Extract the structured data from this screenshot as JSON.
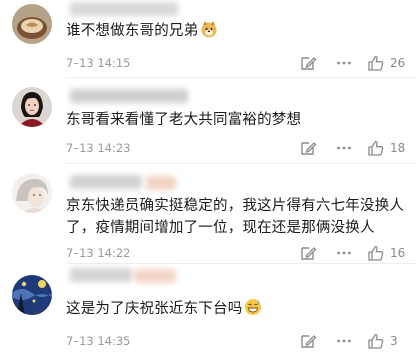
{
  "comments": [
    {
      "text": "谁不想做东哥的兄弟",
      "emoji": "doge-emoji",
      "time": "7–13 14:15",
      "likes": "26"
    },
    {
      "text": "东哥看来看懂了老大共同富裕的梦想",
      "time": "7–13 14:23",
      "likes": "18"
    },
    {
      "text": "京东快递员确实挺稳定的，我这片得有六七年没换人了，疫情期间增加了一位，现在还是那俩没换人",
      "time": "7–13 14:22",
      "likes": "16"
    },
    {
      "text": "这是为了庆祝张近东下台吗",
      "emoji": "grin-sweat-emoji",
      "time": "7–13 14:35",
      "likes": "3"
    }
  ],
  "colors": {
    "icon": "#8c8c8c",
    "time": "#9a9a9a",
    "text": "#1b1b1b"
  }
}
